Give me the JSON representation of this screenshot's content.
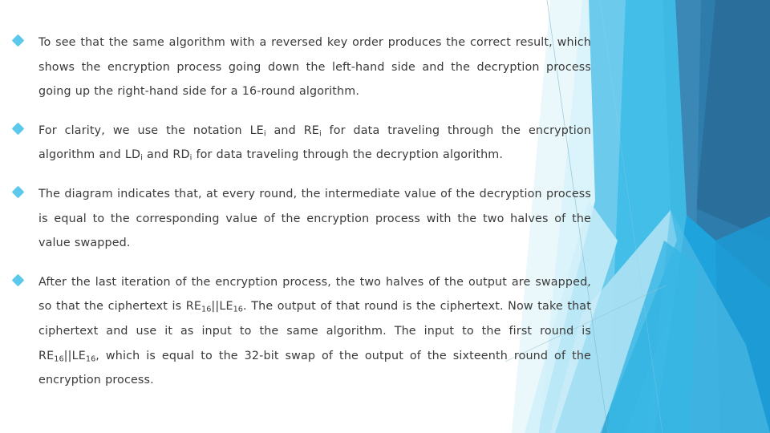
{
  "slide": {
    "background_color": "#FFFFFF",
    "text_color": "#3A3A3A",
    "bullet_color": "#5BC8EC",
    "bullets": [
      {
        "marker": "diamond-bullet",
        "segments": [
          {
            "type": "text",
            "value": "To see that the same algorithm with a reversed key order produces the correct result, which shows the encryption process going down the left-hand side and the decryption process going up the right-hand side for a 16-round algorithm."
          }
        ]
      },
      {
        "marker": "diamond-bullet",
        "segments": [
          {
            "type": "text",
            "value": "For clarity, we use the notation LE"
          },
          {
            "type": "sub",
            "value": "i"
          },
          {
            "type": "text",
            "value": " and RE"
          },
          {
            "type": "sub",
            "value": "i"
          },
          {
            "type": "text",
            "value": " for data traveling through the encryption algorithm and LD"
          },
          {
            "type": "sub",
            "value": "i"
          },
          {
            "type": "text",
            "value": " and RD"
          },
          {
            "type": "sub",
            "value": "i"
          },
          {
            "type": "text",
            "value": " for data traveling through the decryption algorithm."
          }
        ]
      },
      {
        "marker": "diamond-bullet",
        "segments": [
          {
            "type": "text",
            "value": "The diagram indicates that, at every round, the intermediate value of the decryption process is equal to the corresponding value of the encryption process with the two halves of the value swapped."
          }
        ]
      },
      {
        "marker": "diamond-bullet",
        "segments": [
          {
            "type": "text",
            "value": "After the last iteration of the encryption process, the two halves of the output are swapped, so that the ciphertext is RE"
          },
          {
            "type": "sub",
            "value": "16"
          },
          {
            "type": "text",
            "value": "||LE"
          },
          {
            "type": "sub",
            "value": "16"
          },
          {
            "type": "text",
            "value": ". The output of that round is the ciphertext. Now take that ciphertext and use it as input to the same algorithm. The input to the first round is RE"
          },
          {
            "type": "sub",
            "value": "16"
          },
          {
            "type": "text",
            "value": "||LE"
          },
          {
            "type": "sub",
            "value": "16"
          },
          {
            "type": "text",
            "value": ", which is equal to the 32-bit swap of the output of the sixteenth round of the encryption process."
          }
        ]
      }
    ]
  },
  "decoration": {
    "name": "facet-corner-artwork",
    "palette": {
      "pale_ice": "#E8F7FC",
      "light_sky": "#A9DFF3",
      "sky": "#6CCBEC",
      "bright_cyan": "#3FBDE8",
      "azure": "#1FA3DC",
      "mid_blue": "#3B87B5",
      "steel_blue": "#2E7CAC",
      "deep_steel": "#2A6E9B",
      "hairline": "#7FB6C9"
    }
  }
}
